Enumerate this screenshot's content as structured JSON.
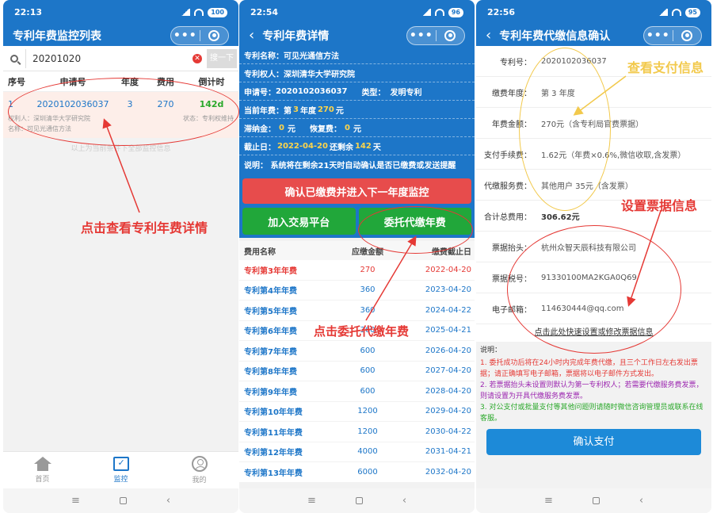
{
  "p1": {
    "time": "22:13",
    "battery": "100",
    "title": "专利年费监控列表",
    "search_value": "20201020",
    "search_btn": "搜一下",
    "headers": [
      "序号",
      "申请号",
      "年度",
      "费用",
      "倒计时"
    ],
    "row": {
      "no": "1",
      "app_no": "2020102036037",
      "year": "3",
      "fee": "270",
      "days": "142d",
      "owner": "权利人：深圳清华大学研究院",
      "status": "状态：专利权维持",
      "name": "名称：可见光通信方法"
    },
    "end_note": "以上为当前条件下全部监控信息",
    "tabs": [
      "首页",
      "监控",
      "我的"
    ],
    "annotation": "点击查看专利年费详情"
  },
  "p2": {
    "time": "22:54",
    "battery": "96",
    "title": "专利年费详情",
    "info": {
      "name_label": "专利名称：",
      "name": "可见光通信方法",
      "owner_label": "专利权人：",
      "owner": "深圳清华大学研究院",
      "app_label": "申请号：",
      "app_no": "2020102036037",
      "type_label": "类型：",
      "type": "发明专利",
      "cur_label": "当前年费：第",
      "cur_year": "3",
      "cur_mid": "年度",
      "cur_fee": "270",
      "cur_unit": "元",
      "late_label": "滞纳金：",
      "late": "0",
      "late_unit": "元",
      "restore_label": "恢复费：",
      "restore": "0",
      "restore_unit": "元",
      "deadline_label": "截止日：",
      "deadline": "2022-04-20",
      "remain_label": "还剩余",
      "remain": "142",
      "remain_unit": "天",
      "note": "说明：  系统将在剩余21天时自动确认是否已缴费或发送提醒"
    },
    "btn_confirm": "确认已缴费并进入下一年度监控",
    "btn_trade": "加入交易平台",
    "btn_entrust": "委托代缴年费",
    "fee_headers": [
      "费用名称",
      "应缴金额",
      "缴费截止日"
    ],
    "fees": [
      {
        "name": "专利第3年年费",
        "amount": "270",
        "date": "2022-04-20"
      },
      {
        "name": "专利第4年年费",
        "amount": "360",
        "date": "2023-04-20"
      },
      {
        "name": "专利第5年年费",
        "amount": "360",
        "date": "2024-04-22"
      },
      {
        "name": "专利第6年年费",
        "amount": "360",
        "date": "2025-04-21"
      },
      {
        "name": "专利第7年年费",
        "amount": "600",
        "date": "2026-04-20"
      },
      {
        "name": "专利第8年年费",
        "amount": "600",
        "date": "2027-04-20"
      },
      {
        "name": "专利第9年年费",
        "amount": "600",
        "date": "2028-04-20"
      },
      {
        "name": "专利第10年年费",
        "amount": "1200",
        "date": "2029-04-20"
      },
      {
        "name": "专利第11年年费",
        "amount": "1200",
        "date": "2030-04-22"
      },
      {
        "name": "专利第12年年费",
        "amount": "4000",
        "date": "2031-04-21"
      },
      {
        "name": "专利第13年年费",
        "amount": "6000",
        "date": "2032-04-20"
      }
    ],
    "annotation": "点击委托代缴年费"
  },
  "p3": {
    "time": "22:56",
    "battery": "95",
    "title": "专利年费代缴信息确认",
    "fields": [
      {
        "label": "专利号：",
        "value": "2020102036037"
      },
      {
        "label": "缴费年度：",
        "value": "第 3 年度"
      },
      {
        "label": "年费金额：",
        "value": "270元（含专利局官费票据）"
      },
      {
        "label": "支付手续费：",
        "value": "1.62元（年费×0.6%,微信收取,含发票）"
      },
      {
        "label": "代缴服务费：",
        "value": "其他用户 35元（含发票）"
      },
      {
        "label": "合计总费用：",
        "value": "306.62元"
      },
      {
        "label": "票据抬头：",
        "value": "杭州众智天辰科技有限公司"
      },
      {
        "label": "票据税号：",
        "value": "91330100MA2KGA0Q69"
      },
      {
        "label": "电子邮箱：",
        "value": "114630444@qq.com"
      }
    ],
    "link": "点击此处快速设置或修改票据信息",
    "notes_title": "说明：",
    "note1": "1. 委托成功后将在24小时内完成年费代缴，且三个工作日左右发出票据；请正确填写电子邮箱，票据将以电子邮件方式发出。",
    "note2": "2. 若票据抬头未设置则默认为第一专利权人；若需要代缴服务费发票，则请设置为开具代缴服务费发票。",
    "note3": "3. 对公支付或批量支付等其他问题则请随时微信咨询管理员或联系在线客服。",
    "pay_btn": "确认支付",
    "annotation_pay": "查看支付信息",
    "annotation_bill": "设置票据信息"
  },
  "colors": {
    "primary": "#1d76c8",
    "red": "#e74c4c",
    "green": "#21a73a",
    "annotation": "#e53935",
    "highlight_yellow": "#f2c94c"
  }
}
